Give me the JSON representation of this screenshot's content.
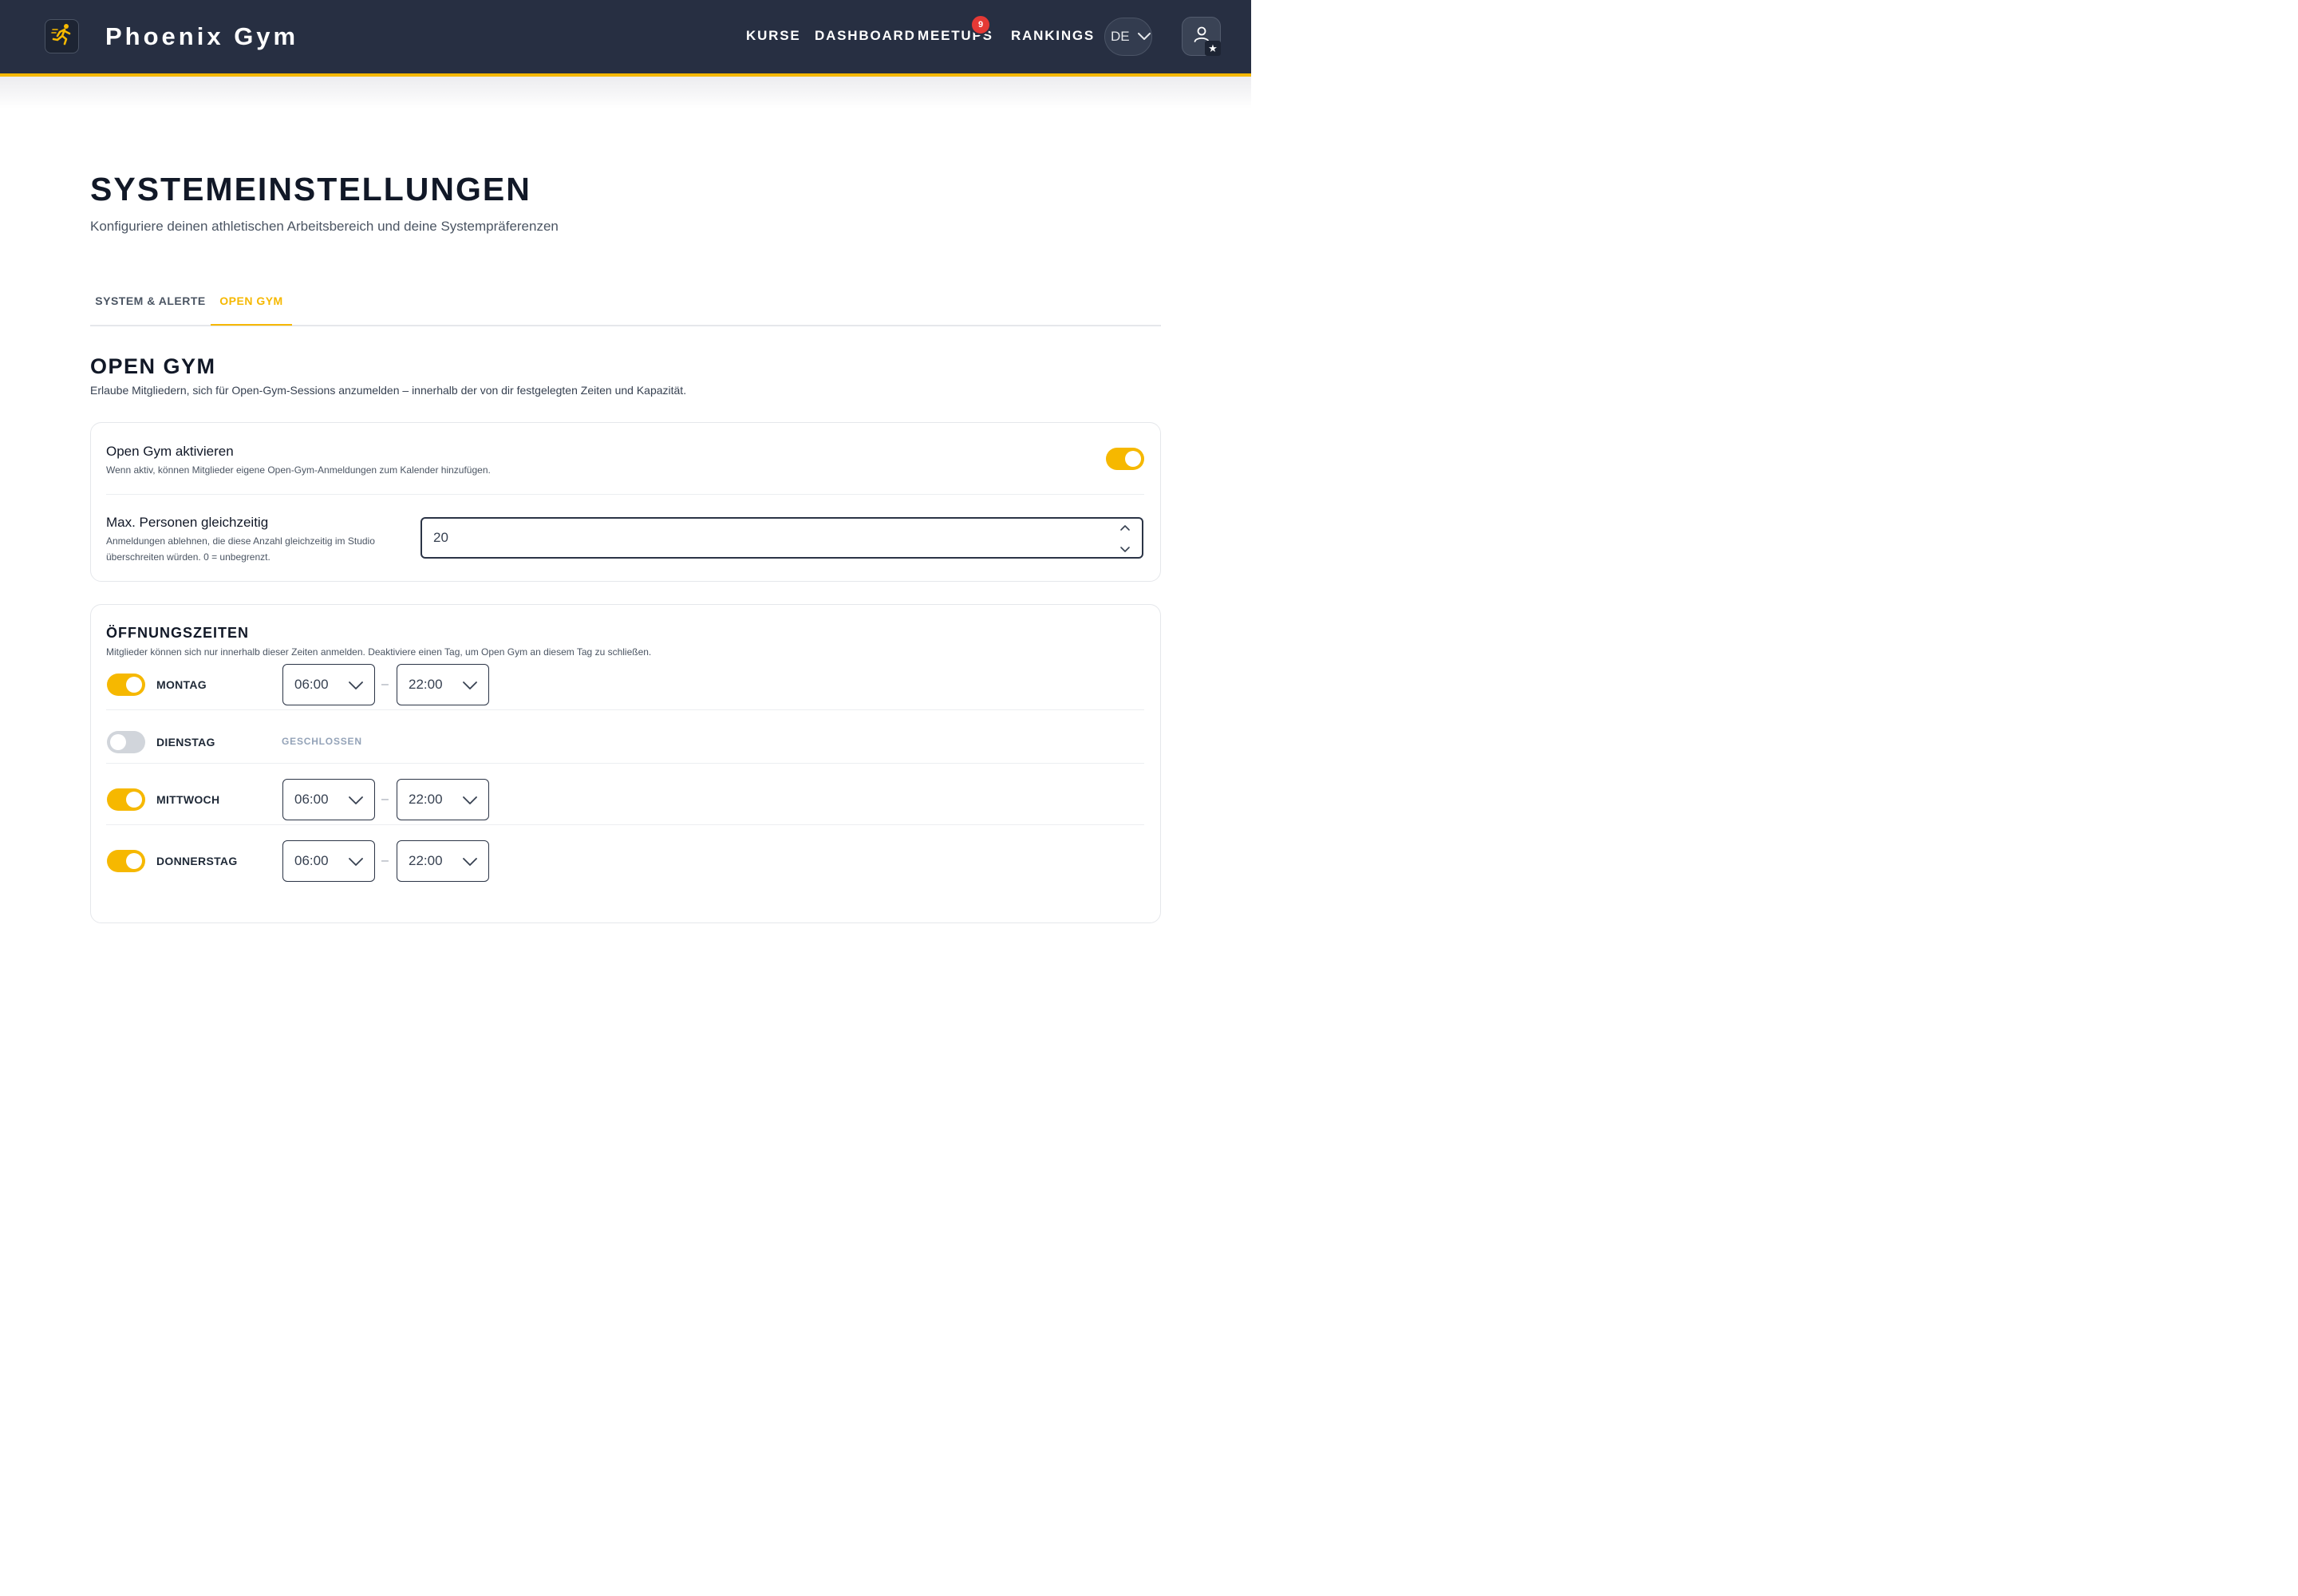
{
  "header": {
    "brand": "Phoenix Gym",
    "nav": {
      "kurse": "KURSE",
      "dashboard": "DASHBOARD",
      "meetups": "MEETUPS",
      "meetups_badge": "9",
      "rankings": "RANKINGS"
    },
    "language": "DE",
    "icons": {
      "logo": "running-figure-icon",
      "user": "user-icon",
      "star": "star-icon",
      "chevron": "chevron-down-icon"
    },
    "colors": {
      "bar": "#272f42",
      "accent": "#f6b800",
      "badge": "#e53935"
    }
  },
  "page": {
    "title": "SYSTEMEINSTELLUNGEN",
    "subtitle": "Konfiguriere deinen athletischen Arbeitsbereich und deine Systempräferenzen"
  },
  "tabs": [
    {
      "label": "SYSTEM & ALERTE",
      "active": false
    },
    {
      "label": "OPEN GYM",
      "active": true
    }
  ],
  "open_gym": {
    "title": "OPEN GYM",
    "description": "Erlaube Mitgliedern, sich für Open-Gym-Sessions anzumelden – innerhalb der von dir festgelegten Zeiten und Kapazität.",
    "enable": {
      "label": "Open Gym aktivieren",
      "help": "Wenn aktiv, können Mitglieder eigene Open-Gym-Anmeldungen zum Kalender hinzufügen.",
      "enabled": true
    },
    "max_people": {
      "label": "Max. Personen gleichzeitig",
      "help": "Anmeldungen ablehnen, die diese Anzahl gleichzeitig im Studio überschreiten würden. 0 = unbegrenzt.",
      "value": "20"
    }
  },
  "opening_hours": {
    "title": "ÖFFNUNGSZEITEN",
    "description": "Mitglieder können sich nur innerhalb dieser Zeiten anmelden. Deaktiviere einen Tag, um Open Gym an diesem Tag zu schließen.",
    "separator": "–",
    "closed_label": "GESCHLOSSEN",
    "days": [
      {
        "label": "MONTAG",
        "enabled": true,
        "from": "06:00",
        "to": "22:00"
      },
      {
        "label": "DIENSTAG",
        "enabled": false
      },
      {
        "label": "MITTWOCH",
        "enabled": true,
        "from": "06:00",
        "to": "22:00"
      },
      {
        "label": "DONNERSTAG",
        "enabled": true,
        "from": "06:00",
        "to": "22:00"
      }
    ]
  }
}
